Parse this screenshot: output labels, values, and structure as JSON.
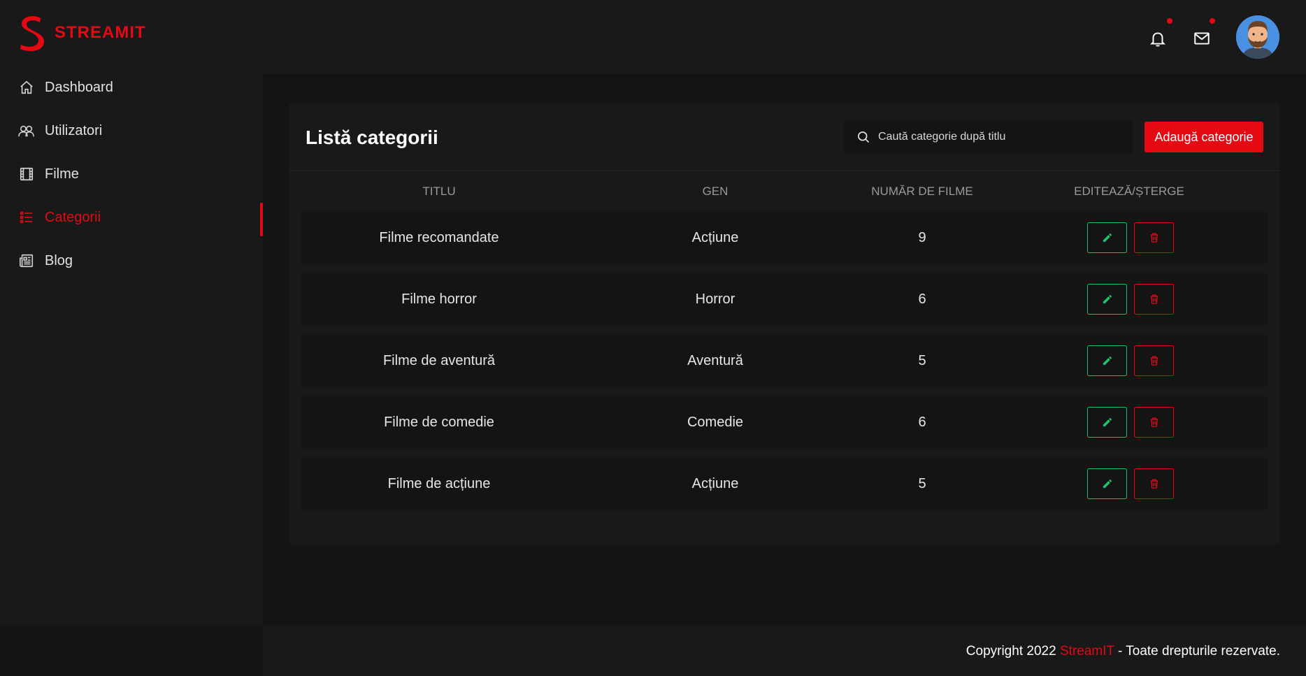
{
  "brand": {
    "name": "STREAMIT",
    "accent_color": "#e50914"
  },
  "sidebar": {
    "items": [
      {
        "label": "Dashboard",
        "icon": "home-icon"
      },
      {
        "label": "Utilizatori",
        "icon": "users-icon"
      },
      {
        "label": "Filme",
        "icon": "film-icon"
      },
      {
        "label": "Categorii",
        "icon": "list-icon",
        "active": true
      },
      {
        "label": "Blog",
        "icon": "newspaper-icon"
      }
    ]
  },
  "header": {
    "icons": [
      "bell-icon",
      "mail-icon"
    ],
    "notification_dot_color": "#e50914"
  },
  "main": {
    "title": "Listă categorii",
    "search": {
      "placeholder": "Caută categorie după titlu",
      "value": ""
    },
    "add_button_label": "Adaugă categorie",
    "table": {
      "columns": [
        "TITLU",
        "GEN",
        "NUMĂR DE FILME",
        "EDITEAZĂ/ȘTERGE"
      ],
      "rows": [
        {
          "title": "Filme recomandate",
          "genre": "Acțiune",
          "count": "9"
        },
        {
          "title": "Filme horror",
          "genre": "Horror",
          "count": "6"
        },
        {
          "title": "Filme de aventură",
          "genre": "Aventură",
          "count": "5"
        },
        {
          "title": "Filme de comedie",
          "genre": "Comedie",
          "count": "6"
        },
        {
          "title": "Filme de acțiune",
          "genre": "Acțiune",
          "count": "5"
        }
      ],
      "edit_color": "#1fc46a",
      "delete_color": "#e50914"
    }
  },
  "footer": {
    "prefix": "Copyright 2022 ",
    "brand": "StreamIT",
    "suffix": " - Toate drepturile rezervate."
  }
}
